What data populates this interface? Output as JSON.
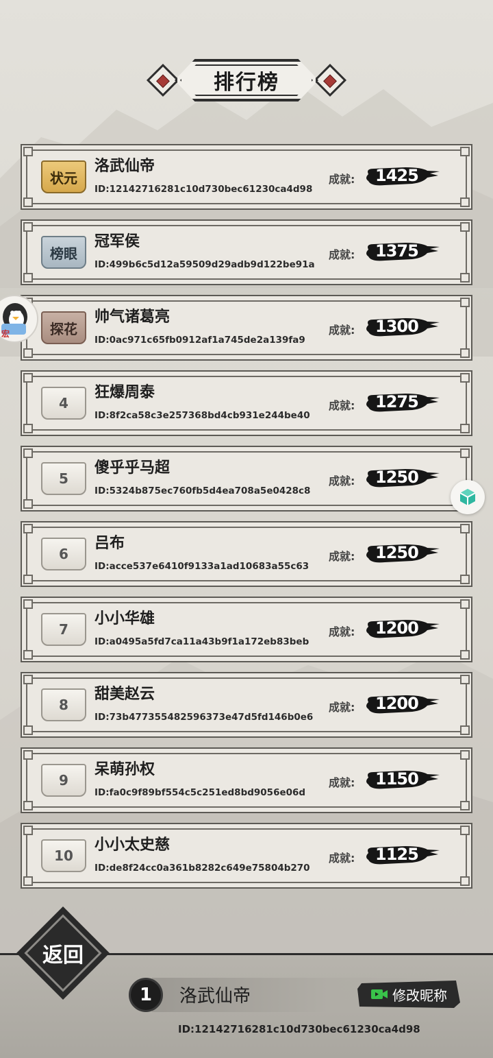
{
  "title": "排行榜",
  "achievement_label": "成就:",
  "entries": [
    {
      "rank_label": "状元",
      "badge": "gold",
      "name": "洛武仙帝",
      "id": "ID:12142716281c10d730bec61230ca4d98",
      "score": "1425"
    },
    {
      "rank_label": "榜眼",
      "badge": "blue",
      "name": "冠军侯",
      "id": "ID:499b6c5d12a59509d29adb9d122be91a",
      "score": "1375"
    },
    {
      "rank_label": "探花",
      "badge": "bronze",
      "name": "帅气诸葛亮",
      "id": "ID:0ac971c65fb0912af1a745de2a139fa9",
      "score": "1300"
    },
    {
      "rank_label": "4",
      "badge": "plain",
      "name": "狂爆周泰",
      "id": "ID:8f2ca58c3e257368bd4cb931e244be40",
      "score": "1275"
    },
    {
      "rank_label": "5",
      "badge": "plain",
      "name": "傻乎乎马超",
      "id": "ID:5324b875ec760fb5d4ea708a5e0428c8",
      "score": "1250"
    },
    {
      "rank_label": "6",
      "badge": "plain",
      "name": "吕布",
      "id": "ID:acce537e6410f9133a1ad10683a55c63",
      "score": "1250"
    },
    {
      "rank_label": "7",
      "badge": "plain",
      "name": "小小华雄",
      "id": "ID:a0495a5fd7ca11a43b9f1a172eb83beb",
      "score": "1200"
    },
    {
      "rank_label": "8",
      "badge": "plain",
      "name": "甜美赵云",
      "id": "ID:73b477355482596373e47d5fd146b0e6",
      "score": "1200"
    },
    {
      "rank_label": "9",
      "badge": "plain",
      "name": "呆萌孙权",
      "id": "ID:fa0c9f89bf554c5c251ed8bd9056e06d",
      "score": "1150"
    },
    {
      "rank_label": "10",
      "badge": "plain",
      "name": "小小太史慈",
      "id": "ID:de8f24cc0a361b8282c649e75804b270",
      "score": "1125"
    }
  ],
  "back_label": "返回",
  "floating_left_text": "宏",
  "my_entry": {
    "rank": "1",
    "name": "洛武仙帝",
    "id": "ID:12142716281c10d730bec61230ca4d98",
    "rename_label": "修改昵称"
  },
  "colors": {
    "background": "#dcdad3",
    "card": "#ebe8e2",
    "gold_badge": "#d6a84c",
    "blue_badge": "#a9b7c1",
    "bronze_badge": "#a98d80",
    "accent_green": "#39c24a",
    "title_gem_red": "#a63a36"
  },
  "icons": {
    "rename": "video-camera-icon",
    "floating_right": "cube-icon",
    "floating_left": "penguin-avatar-icon"
  }
}
